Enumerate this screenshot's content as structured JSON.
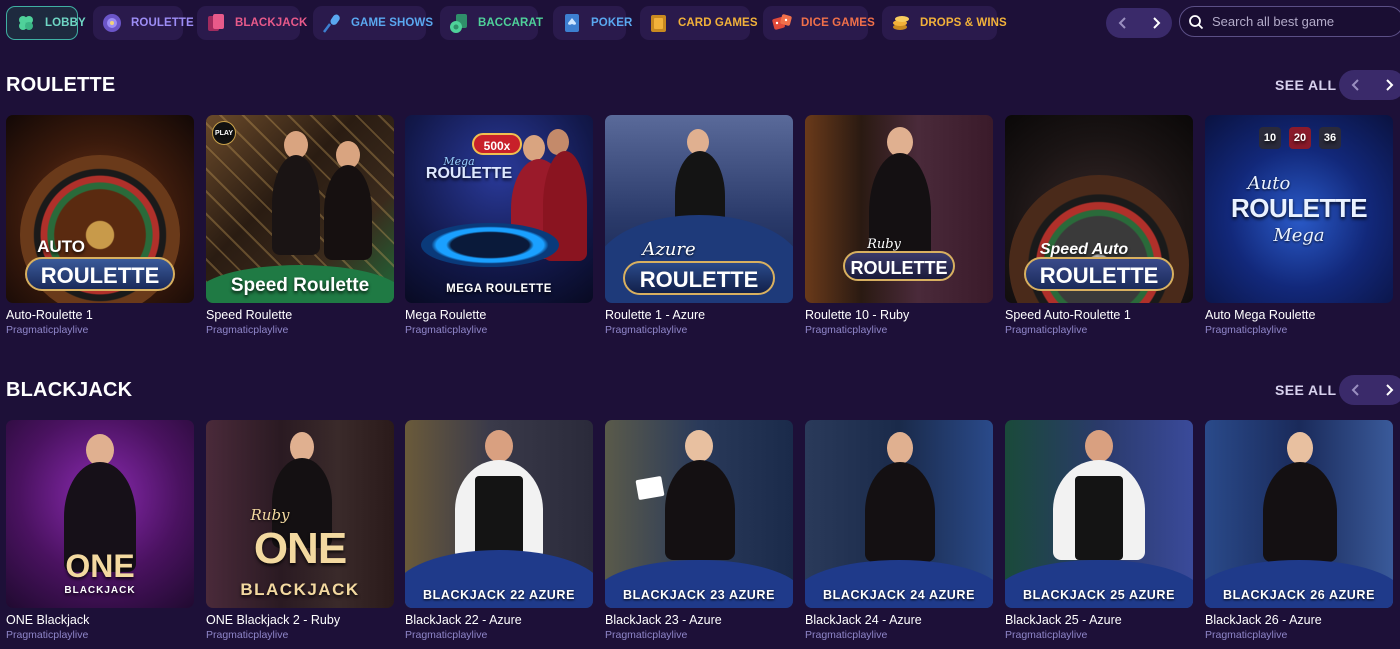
{
  "nav": {
    "categories": [
      {
        "label": "LOBBY",
        "icon": "clover-icon",
        "active": true
      },
      {
        "label": "ROULETTE",
        "icon": "roulette-icon"
      },
      {
        "label": "BLACKJACK",
        "icon": "cards-icon"
      },
      {
        "label": "GAME SHOWS",
        "icon": "microphone-icon"
      },
      {
        "label": "BACCARAT",
        "icon": "chip-icon"
      },
      {
        "label": "POKER",
        "icon": "spade-card-icon"
      },
      {
        "label": "CARD GAMES",
        "icon": "card-deck-icon"
      },
      {
        "label": "DICE GAMES",
        "icon": "dice-icon"
      },
      {
        "label": "DROPS & WINS",
        "icon": "coins-icon"
      }
    ],
    "search_placeholder": "Search all best game"
  },
  "colors": {
    "background": "#1d1038",
    "active_border": "#3fb0a3",
    "provider_text": "#8f86c9"
  },
  "sections": [
    {
      "title": "ROULETTE",
      "see_all": "SEE ALL",
      "games": [
        {
          "name": "Auto-Roulette 1",
          "provider": "Pragmaticplaylive",
          "art_line1": "AUTO",
          "art_line2": "ROULETTE"
        },
        {
          "name": "Speed Roulette",
          "provider": "Pragmaticplaylive",
          "art_line1": "PLAY",
          "art_line2": "Speed Roulette"
        },
        {
          "name": "Mega Roulette",
          "provider": "Pragmaticplaylive",
          "art_line1": "500x",
          "art_line2": "MEGA ROULETTE",
          "art_line3": "Mega",
          "art_line4": "ROULETTE"
        },
        {
          "name": "Roulette 1 - Azure",
          "provider": "Pragmaticplaylive",
          "art_line1": "Azure",
          "art_line2": "ROULETTE"
        },
        {
          "name": "Roulette 10 - Ruby",
          "provider": "Pragmaticplaylive",
          "art_line1": "Ruby",
          "art_line2": "ROULETTE"
        },
        {
          "name": "Speed Auto-Roulette 1",
          "provider": "Pragmaticplaylive",
          "art_line1": "Speed Auto",
          "art_line2": "ROULETTE"
        },
        {
          "name": "Auto Mega Roulette",
          "provider": "Pragmaticplaylive",
          "art_line1": "Mega",
          "art_line2": "ROULETTE",
          "art_line3": "Auto",
          "art_line4": "10",
          "art_line5": "20",
          "art_line6": "36"
        }
      ]
    },
    {
      "title": "BLACKJACK",
      "see_all": "SEE ALL",
      "games": [
        {
          "name": "ONE Blackjack",
          "provider": "Pragmaticplaylive",
          "art_line1": "ONE",
          "art_line2": "BLACKJACK"
        },
        {
          "name": "ONE Blackjack 2 - Ruby",
          "provider": "Pragmaticplaylive",
          "art_line1": "Ruby",
          "art_line2": "ONE",
          "art_line3": "BLACKJACK"
        },
        {
          "name": "BlackJack 22 - Azure",
          "provider": "Pragmaticplaylive",
          "art_line1": "BLACKJACK 22 AZURE"
        },
        {
          "name": "BlackJack 23 - Azure",
          "provider": "Pragmaticplaylive",
          "art_line1": "BLACKJACK 23 AZURE"
        },
        {
          "name": "BlackJack 24 - Azure",
          "provider": "Pragmaticplaylive",
          "art_line1": "BLACKJACK 24 AZURE"
        },
        {
          "name": "BlackJack 25 - Azure",
          "provider": "Pragmaticplaylive",
          "art_line1": "BLACKJACK 25 AZURE"
        },
        {
          "name": "BlackJack 26 - Azure",
          "provider": "Pragmaticplaylive",
          "art_line1": "BLACKJACK 26 AZURE"
        }
      ]
    }
  ]
}
